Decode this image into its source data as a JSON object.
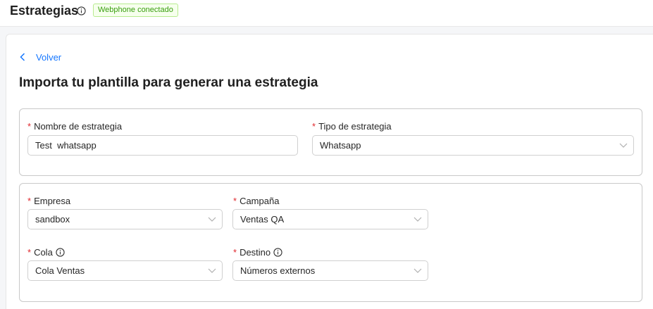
{
  "header": {
    "title": "Estrategias",
    "status_badge": "Webphone conectado",
    "status_color": "#389e0d"
  },
  "nav": {
    "back_label": "Volver"
  },
  "main": {
    "heading": "Importa tu plantilla para generar una estrategia"
  },
  "form": {
    "nombre": {
      "label": "Nombre de estrategia",
      "value": "Test  whatsapp"
    },
    "tipo": {
      "label": "Tipo de estrategia",
      "value": "Whatsapp"
    },
    "empresa": {
      "label": "Empresa",
      "value": "sandbox"
    },
    "campana": {
      "label": "Campaña",
      "value": "Ventas QA"
    },
    "cola": {
      "label": "Cola",
      "value": "Cola Ventas"
    },
    "destino": {
      "label": "Destino",
      "value": "Números externos"
    },
    "required_marker": "*"
  },
  "colors": {
    "accent": "#1677ff",
    "required": "#e0282e"
  }
}
